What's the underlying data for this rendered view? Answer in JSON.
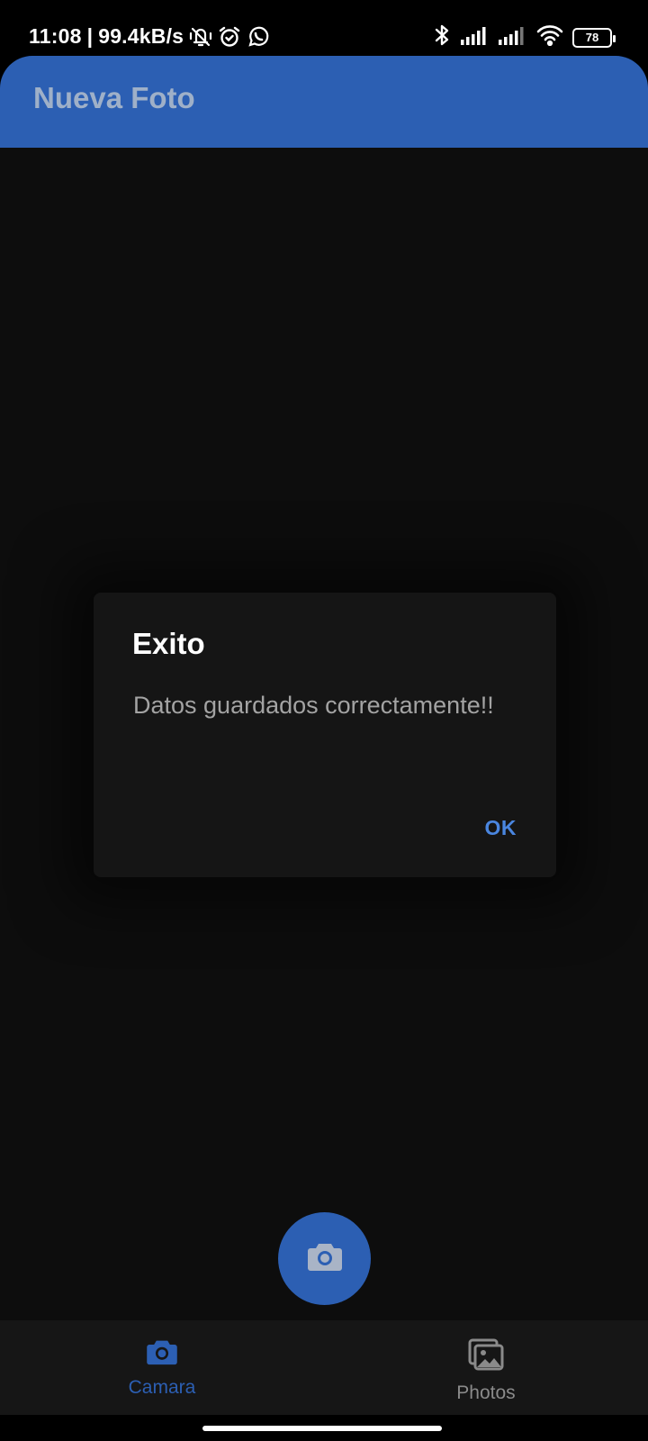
{
  "status_bar": {
    "time": "11:08",
    "separator": "|",
    "network_speed": "99.4kB/s",
    "battery_level": "78",
    "left_icons": [
      "vibrate-off-icon",
      "alarm-icon",
      "whatsapp-icon"
    ],
    "right_icons": [
      "bluetooth-icon",
      "signal-icon",
      "signal-icon",
      "wifi-icon",
      "battery-icon"
    ]
  },
  "app_bar": {
    "title": "Nueva Foto"
  },
  "dialog": {
    "title": "Exito",
    "message": "Datos guardados correctamente!!",
    "ok_label": "OK"
  },
  "fab": {
    "icon": "camera-icon"
  },
  "bottom_nav": {
    "items": [
      {
        "label": "Camara",
        "icon": "camera-icon",
        "active": true
      },
      {
        "label": "Photos",
        "icon": "photos-icon",
        "active": false
      }
    ]
  },
  "colors": {
    "primary": "#2c5fb3",
    "accent": "#4a86e0",
    "background": "#0d0d0d",
    "dialog": "#151515",
    "nav_background": "#161616"
  }
}
